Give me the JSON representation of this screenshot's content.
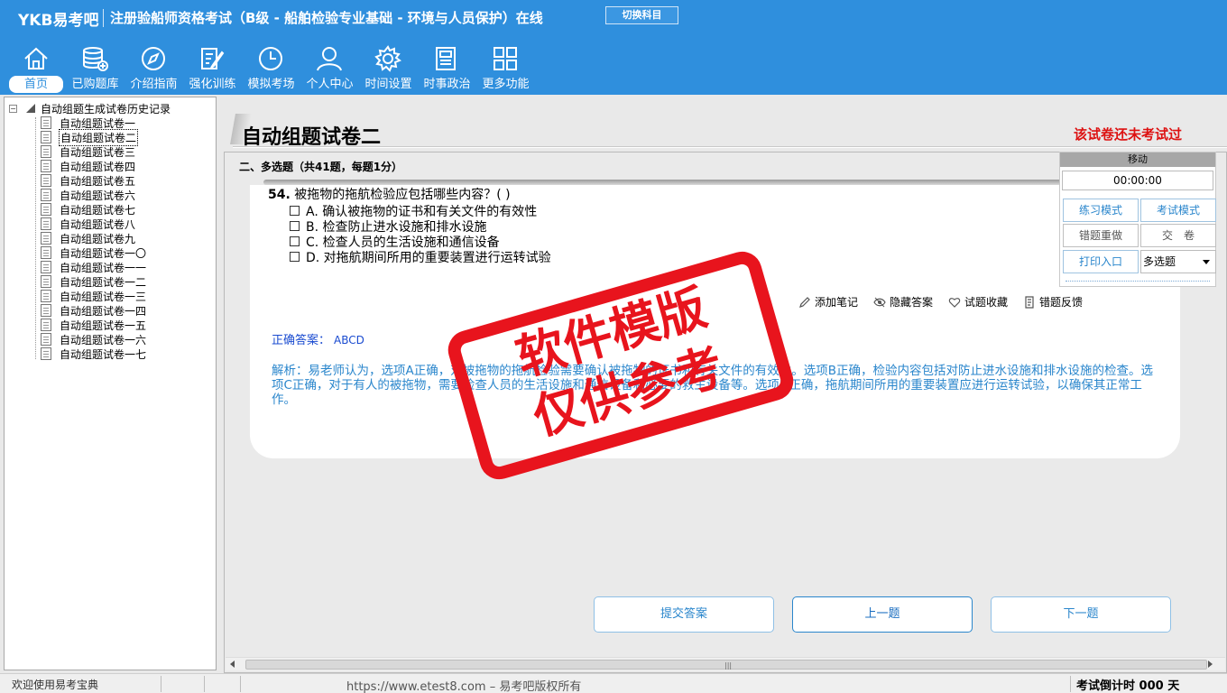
{
  "header": {
    "brand": "YKB易考吧",
    "title": "注册验船师资格考试（B级 - 船舶检验专业基础 - 环境与人员保护）在线",
    "switch_label": "切换科目"
  },
  "nav": [
    {
      "label": "首页",
      "icon": "home-icon"
    },
    {
      "label": "已购题库",
      "icon": "database-icon"
    },
    {
      "label": "介绍指南",
      "icon": "compass-icon"
    },
    {
      "label": "强化训练",
      "icon": "edit-icon"
    },
    {
      "label": "模拟考场",
      "icon": "clock-icon"
    },
    {
      "label": "个人中心",
      "icon": "user-icon"
    },
    {
      "label": "时间设置",
      "icon": "gear-icon"
    },
    {
      "label": "时事政治",
      "icon": "news-icon"
    },
    {
      "label": "更多功能",
      "icon": "grid-icon"
    }
  ],
  "tree": {
    "root": "自动组题生成试卷历史记录",
    "items": [
      "自动组题试卷一",
      "自动组题试卷二",
      "自动组题试卷三",
      "自动组题试卷四",
      "自动组题试卷五",
      "自动组题试卷六",
      "自动组题试卷七",
      "自动组题试卷八",
      "自动组题试卷九",
      "自动组题试卷一〇",
      "自动组题试卷一一",
      "自动组题试卷一二",
      "自动组题试卷一三",
      "自动组题试卷一四",
      "自动组题试卷一五",
      "自动组题试卷一六",
      "自动组题试卷一七"
    ],
    "selected_index": 1
  },
  "paper": {
    "title": "自动组题试卷二",
    "status": "该试卷还未考试过",
    "section": "二、多选题（共41题，每题1分）"
  },
  "question": {
    "number": "54.",
    "text": "被拖物的拖航检验应包括哪些内容？( )",
    "options": [
      "A. 确认被拖物的证书和有关文件的有效性",
      "B. 检查防止进水设施和排水设施",
      "C. 检查人员的生活设施和通信设备",
      "D. 对拖航期间所用的重要装置进行运转试验"
    ]
  },
  "tools": {
    "note": "添加笔记",
    "hide": "隐藏答案",
    "fav": "试题收藏",
    "report": "错题反馈"
  },
  "answer": {
    "label": "正确答案：",
    "value": "ABCD"
  },
  "analysis": "解析：易老师认为，选项A正确，对被拖物的拖航检验需要确认被拖物的证书和有关文件的有效性。选项B正确，检验内容包括对防止进水设施和排水设施的检查。选项C正确，对于有人的被拖物，需要检查人员的生活设施和通信设备和必要的救生设备等。选项D正确，拖航期间所用的重要装置应进行运转试验，以确保其正常工作。",
  "panel": {
    "head": "移动",
    "time": "00:00:00",
    "practice": "练习模式",
    "exam": "考试模式",
    "redo": "错题重做",
    "submit": "交　卷",
    "print": "打印入口",
    "type_select": "多选题"
  },
  "buttons": {
    "submit": "提交答案",
    "prev": "上一题",
    "next": "下一题"
  },
  "status": {
    "welcome": "欢迎使用易考宝典",
    "copyright": "https://www.etest8.com – 易考吧版权所有",
    "countdown": "考试倒计时 000 天"
  },
  "watermark": {
    "line1": "软件模版",
    "line2": "仅供参考"
  },
  "colors": {
    "header_blue": "#2f8fdd",
    "status_red": "#dd1111",
    "answer_blue": "#1a4bd0",
    "analysis_blue": "#2a86cc",
    "stamp_red": "#e8141d"
  }
}
